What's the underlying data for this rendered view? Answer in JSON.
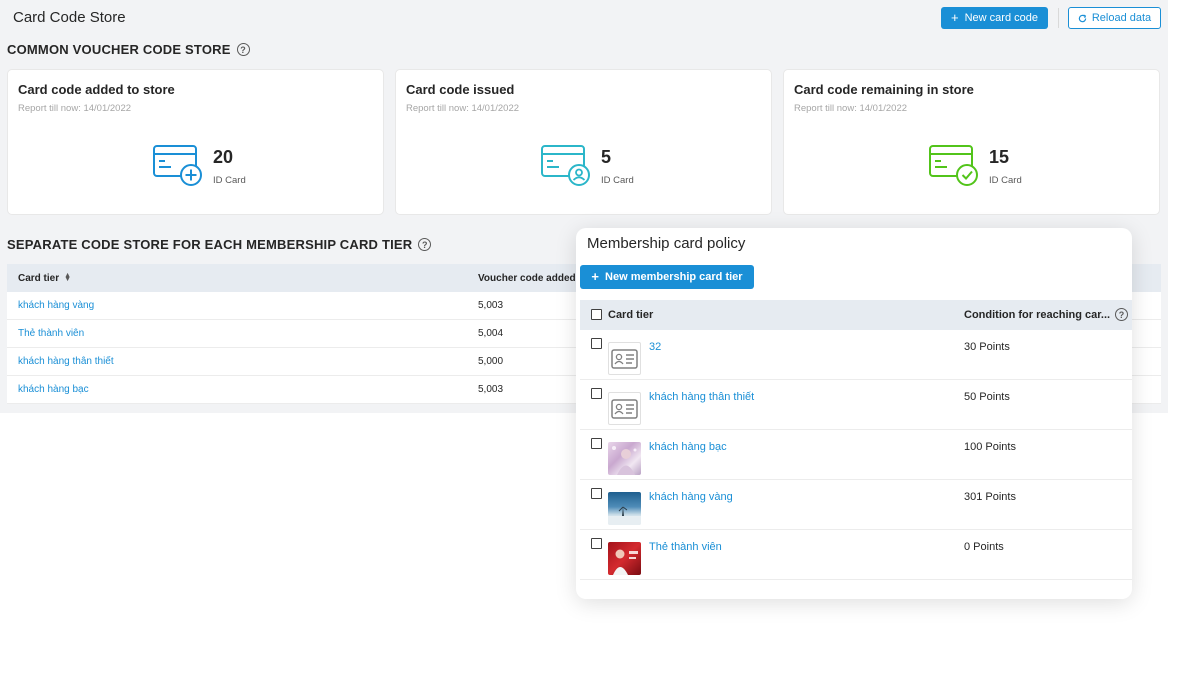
{
  "header": {
    "title": "Card Code Store",
    "new_card_code": "New card code",
    "reload_data": "Reload data"
  },
  "common_section": {
    "title": "COMMON VOUCHER CODE STORE",
    "help_icon": "?"
  },
  "stat_cards": [
    {
      "title": "Card code added to store",
      "subtitle": "Report till now: 14/01/2022",
      "value": "20",
      "unit": "ID Card",
      "icon": "card-add-icon",
      "color": "#1a8fd6"
    },
    {
      "title": "Card code issued",
      "subtitle": "Report till now: 14/01/2022",
      "value": "5",
      "unit": "ID Card",
      "icon": "card-user-icon",
      "color": "#2bb6c9"
    },
    {
      "title": "Card code remaining in store",
      "subtitle": "Report till now: 14/01/2022",
      "value": "15",
      "unit": "ID Card",
      "icon": "card-check-icon",
      "color": "#52c41a"
    }
  ],
  "separate_section": {
    "title": "SEPARATE CODE STORE FOR EACH MEMBERSHIP CARD TIER",
    "help_icon": "?"
  },
  "tier_table": {
    "columns": [
      "Card tier",
      "Voucher code added"
    ],
    "rows": [
      {
        "tier": "khách hàng vàng",
        "added": "5,003"
      },
      {
        "tier": "Thẻ thành viên",
        "added": "5,004"
      },
      {
        "tier": "khách hàng thân thiết",
        "added": "5,000"
      },
      {
        "tier": "khách hàng bạc",
        "added": "5,003"
      }
    ]
  },
  "policy_panel": {
    "title": "Membership card policy",
    "new_tier": "New membership card tier",
    "columns": {
      "tier": "Card tier",
      "condition": "Condition for reaching car...",
      "help_icon": "?"
    },
    "rows": [
      {
        "name": "32",
        "condition": "30 Points",
        "thumb": "id-card-icon"
      },
      {
        "name": "khách hàng thân thiết",
        "condition": "50 Points",
        "thumb": "id-card-icon"
      },
      {
        "name": "khách hàng bạc",
        "condition": "100 Points",
        "thumb": "photo-lavender"
      },
      {
        "name": "khách hàng vàng",
        "condition": "301 Points",
        "thumb": "photo-sky"
      },
      {
        "name": "Thẻ thành viên",
        "condition": "0 Points",
        "thumb": "photo-red"
      }
    ]
  }
}
